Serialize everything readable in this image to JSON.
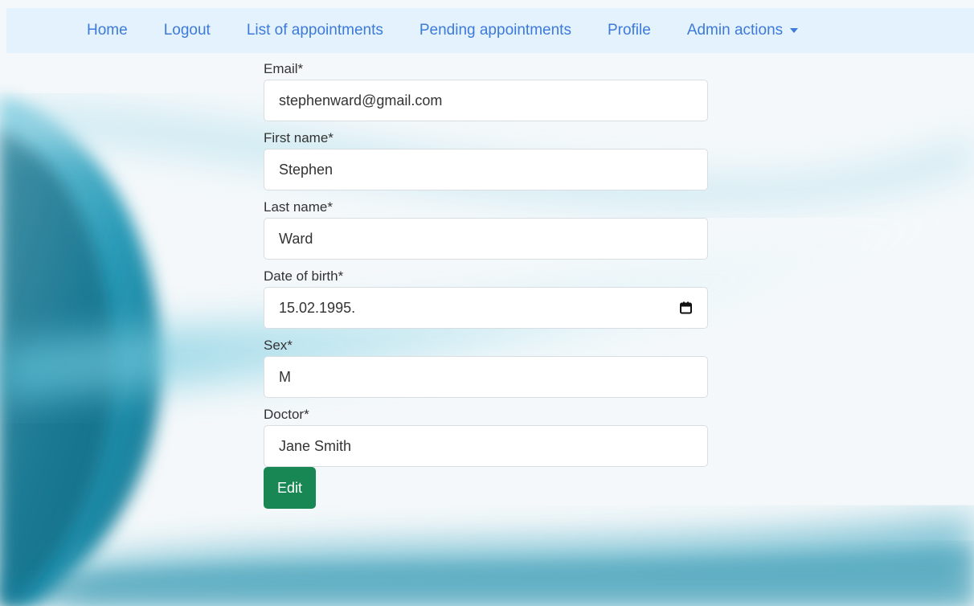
{
  "nav": {
    "items": [
      {
        "label": "Home"
      },
      {
        "label": "Logout"
      },
      {
        "label": "List of appointments"
      },
      {
        "label": "Pending appointments"
      },
      {
        "label": "Profile"
      }
    ],
    "dropdown_label": "Admin actions"
  },
  "form": {
    "fields": [
      {
        "label": "Email*",
        "value": "stephenward@gmail.com"
      },
      {
        "label": "First name*",
        "value": "Stephen"
      },
      {
        "label": "Last name*",
        "value": "Ward"
      },
      {
        "label": "Date of birth*",
        "value": "15.02.1995.",
        "icon": "calendar-icon"
      },
      {
        "label": "Sex*",
        "value": "M"
      },
      {
        "label": "Doctor*",
        "value": "Jane Smith"
      }
    ],
    "submit_label": "Edit"
  },
  "colors": {
    "nav_bg": "#e3f2fd",
    "nav_link": "#3d7ad9",
    "button_bg": "#198754"
  }
}
